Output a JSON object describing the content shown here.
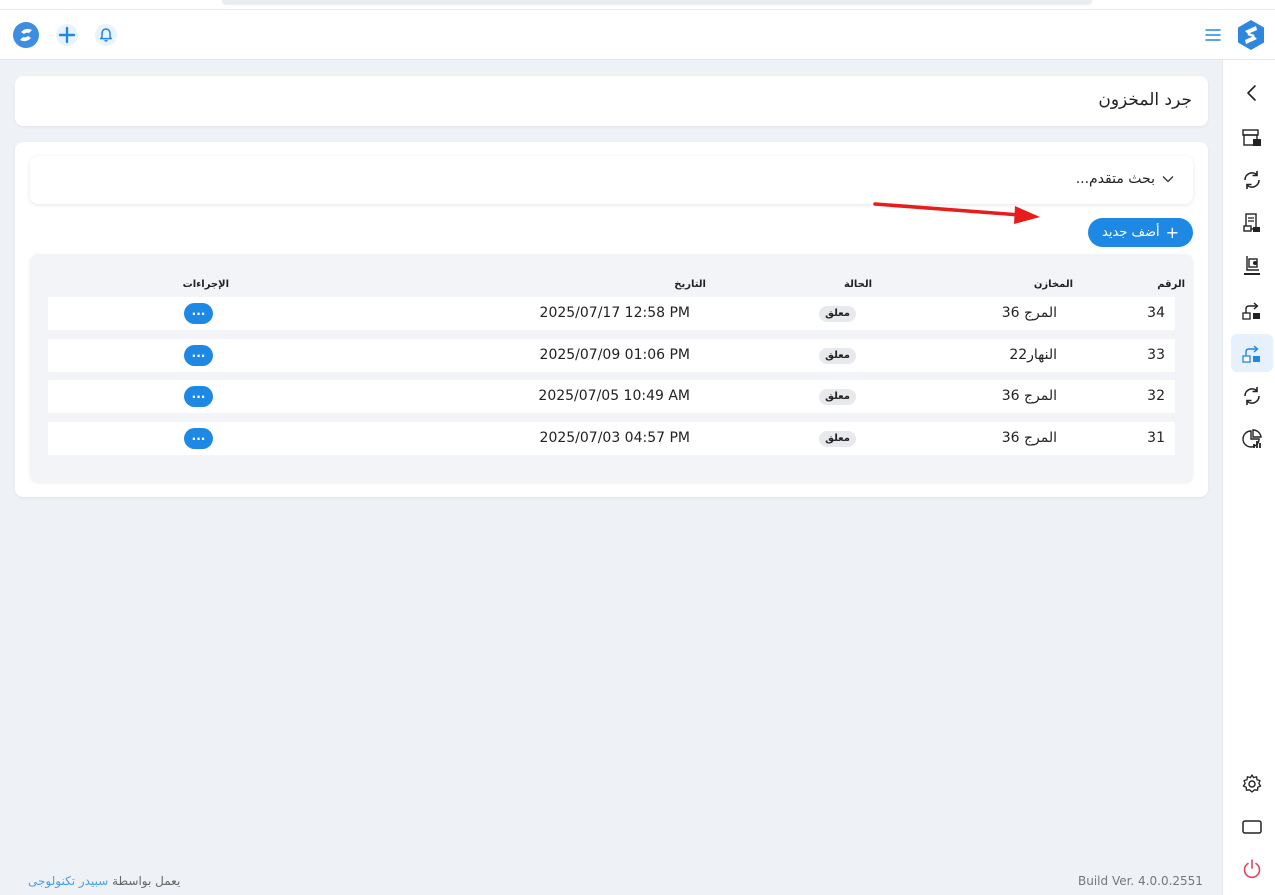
{
  "page": {
    "title": "جرد المخزون"
  },
  "search": {
    "advanced_label": "بحث متقدم..."
  },
  "actions": {
    "add_new_label": "أضف جديد"
  },
  "table": {
    "columns": [
      "الرقم",
      "المخازن",
      "الحالة",
      "التاريخ",
      "الإجراءات"
    ],
    "rows": [
      {
        "id": "34",
        "warehouse": "المرج 36",
        "status": "معلق",
        "date": "2025/07/17 12:58 PM"
      },
      {
        "id": "33",
        "warehouse": "النهار22",
        "status": "معلق",
        "date": "2025/07/09 01:06 PM"
      },
      {
        "id": "32",
        "warehouse": "المرج 36",
        "status": "معلق",
        "date": "2025/07/05 10:49 AM"
      },
      {
        "id": "31",
        "warehouse": "المرج 36",
        "status": "معلق",
        "date": "2025/07/03 04:57 PM"
      }
    ],
    "action_label": "···"
  },
  "footer": {
    "powered_prefix": "يعمل بواسطة",
    "powered_brand": "سبيدر تكنولوجى",
    "build": "Build Ver. 4.0.0.2551"
  },
  "icons": {
    "header": [
      "logo-icon",
      "plus-icon",
      "bell-icon",
      "menu-icon",
      "logo-icon"
    ],
    "sidebar": [
      "chevron-left-icon",
      "inventory-store-icon",
      "sync-icon",
      "receipt-icon",
      "stock-count-icon",
      "transfer-out-icon",
      "transfer-in-icon",
      "sync-icon",
      "report-chart-icon",
      "gear-icon",
      "window-icon",
      "power-icon"
    ]
  },
  "colors": {
    "accent": "#1e88e5",
    "page_bg": "#eef1f5",
    "badge_bg": "#e7e9ec",
    "power": "#e2435a",
    "arrow": "#e81c1c"
  }
}
